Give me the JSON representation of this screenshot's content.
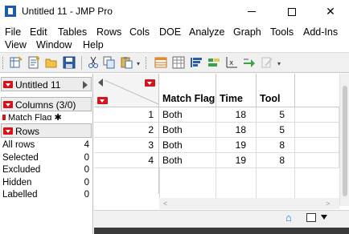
{
  "window": {
    "title": "Untitled 11 - JMP Pro"
  },
  "menu": [
    "File",
    "Edit",
    "Tables",
    "Rows",
    "Cols",
    "DOE",
    "Analyze",
    "Graph",
    "Tools",
    "Add-Ins",
    "View",
    "Window",
    "Help"
  ],
  "left_panel": {
    "table_name": "Untitled 11",
    "columns_header": "Columns (3/0)",
    "column_item_partial": "Match Flag",
    "rows_header": "Rows",
    "row_states": [
      {
        "label": "All rows",
        "value": "4"
      },
      {
        "label": "Selected",
        "value": "0"
      },
      {
        "label": "Excluded",
        "value": "0"
      },
      {
        "label": "Hidden",
        "value": "0"
      },
      {
        "label": "Labelled",
        "value": "0"
      }
    ]
  },
  "grid": {
    "columns": [
      "Match Flag",
      "Time",
      "Tool"
    ],
    "rows": [
      {
        "n": "1",
        "cells": [
          "Both",
          "18",
          "5"
        ]
      },
      {
        "n": "2",
        "cells": [
          "Both",
          "18",
          "5"
        ]
      },
      {
        "n": "3",
        "cells": [
          "Both",
          "19",
          "8"
        ]
      },
      {
        "n": "4",
        "cells": [
          "Both",
          "19",
          "8"
        ]
      }
    ]
  },
  "status": {
    "icons": [
      "home-icon",
      "window-square-icon",
      "dropdown-icon"
    ]
  },
  "colors": {
    "red_hotspot": "#d5131a",
    "accent_blue": "#1a5da8"
  }
}
